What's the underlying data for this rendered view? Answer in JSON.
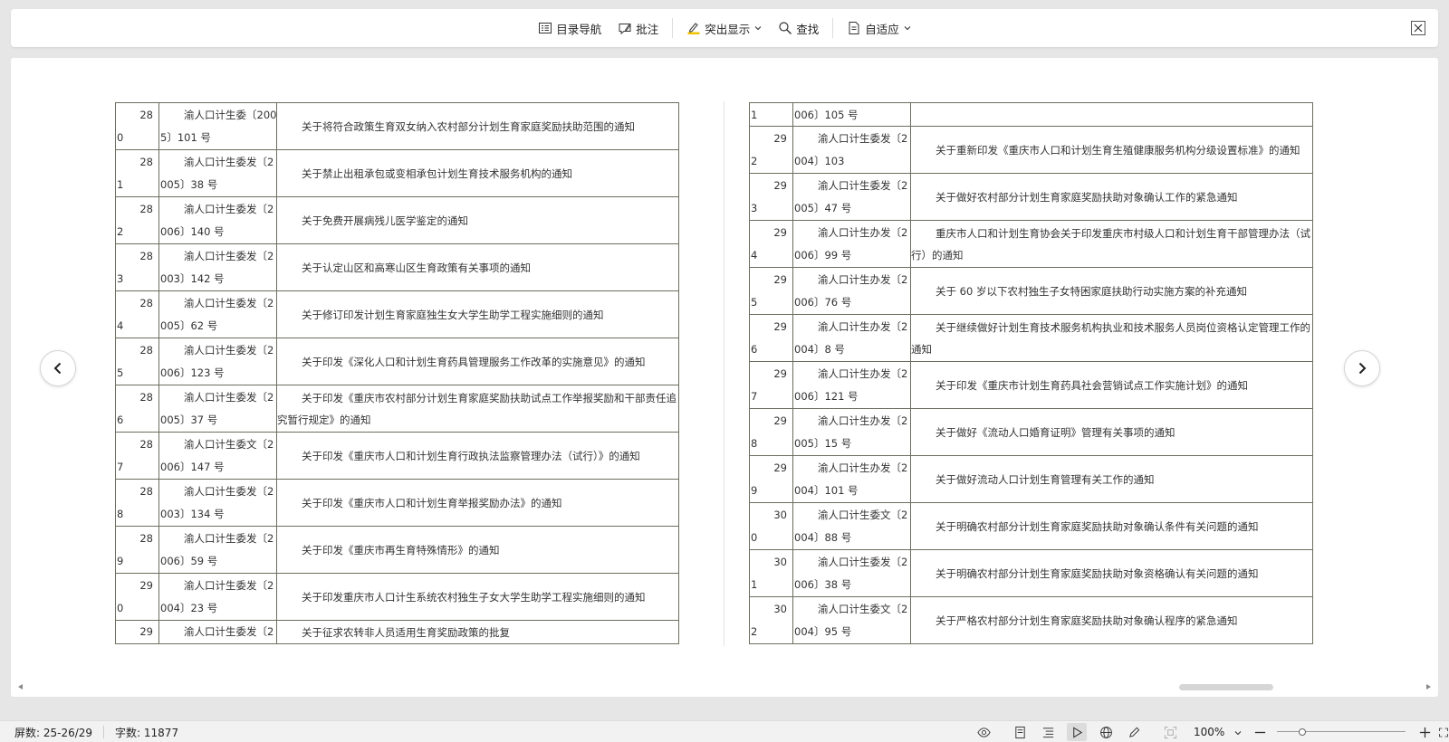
{
  "toolbar": {
    "toc_label": "目录导航",
    "annotate_label": "批注",
    "highlight_label": "突出显示",
    "find_label": "查找",
    "fit_label": "自适应"
  },
  "left_rows": [
    {
      "num1": "28",
      "num2": "0",
      "doc1": "渝人口计生委〔200",
      "doc2": "5〕101 号",
      "title": "关于将符合政策生育双女纳入农村部分计划生育家庭奖励扶助范围的通知"
    },
    {
      "num1": "28",
      "num2": "1",
      "doc1": "渝人口计生委发〔2",
      "doc2": "005〕38 号",
      "title": "关于禁止出租承包或变相承包计划生育技术服务机构的通知"
    },
    {
      "num1": "28",
      "num2": "2",
      "doc1": "渝人口计生委发〔2",
      "doc2": "006〕140 号",
      "title": "关于免费开展病残儿医学鉴定的通知"
    },
    {
      "num1": "28",
      "num2": "3",
      "doc1": "渝人口计生委发〔2",
      "doc2": "003〕142 号",
      "title": "关于认定山区和高寒山区生育政策有关事项的通知"
    },
    {
      "num1": "28",
      "num2": "4",
      "doc1": "渝人口计生委发〔2",
      "doc2": "005〕62 号",
      "title": "关于修订印发计划生育家庭独生女大学生助学工程实施细则的通知"
    },
    {
      "num1": "28",
      "num2": "5",
      "doc1": "渝人口计生委发〔2",
      "doc2": "006〕123 号",
      "title": "关于印发《深化人口和计划生育药具管理服务工作改革的实施意见》的通知"
    },
    {
      "num1": "28",
      "num2": "6",
      "doc1": "渝人口计生委发〔2",
      "doc2": "005〕37 号",
      "title": "关于印发《重庆市农村部分计划生育家庭奖励扶助试点工作举报奖励和干部责任追究暂行规定》的通知"
    },
    {
      "num1": "28",
      "num2": "7",
      "doc1": "渝人口计生委文〔2",
      "doc2": "006〕147 号",
      "title": "关于印发《重庆市人口和计划生育行政执法监察管理办法（试行）》的通知"
    },
    {
      "num1": "28",
      "num2": "8",
      "doc1": "渝人口计生委发〔2",
      "doc2": "003〕134 号",
      "title": "关于印发《重庆市人口和计划生育举报奖励办法》的通知"
    },
    {
      "num1": "28",
      "num2": "9",
      "doc1": "渝人口计生委发〔2",
      "doc2": "006〕59 号",
      "title": "关于印发《重庆市再生育特殊情形》的通知"
    },
    {
      "num1": "29",
      "num2": "0",
      "doc1": "渝人口计生委发〔2",
      "doc2": "004〕23 号",
      "title": "关于印发重庆市人口计生系统农村独生子女大学生助学工程实施细则的通知"
    },
    {
      "num1": "29",
      "num2": "",
      "doc1": "渝人口计生委发〔2",
      "doc2": "",
      "title": "关于征求农转非人员适用生育奖励政策的批复"
    }
  ],
  "right_top_row": {
    "num": "1",
    "doc": "006〕105 号",
    "title": ""
  },
  "right_rows": [
    {
      "num1": "29",
      "num2": "2",
      "doc1": "渝人口计生委发〔2",
      "doc2": "004〕103",
      "title": "关于重新印发《重庆市人口和计划生育生殖健康服务机构分级设置标准》的通知"
    },
    {
      "num1": "29",
      "num2": "3",
      "doc1": "渝人口计生委发〔2",
      "doc2": "005〕47 号",
      "title": "关于做好农村部分计划生育家庭奖励扶助对象确认工作的紧急通知"
    },
    {
      "num1": "29",
      "num2": "4",
      "doc1": "渝人口计生办发〔2",
      "doc2": "006〕99 号",
      "title": "重庆市人口和计划生育协会关于印发重庆市村级人口和计划生育干部管理办法（试行）的通知"
    },
    {
      "num1": "29",
      "num2": "5",
      "doc1": "渝人口计生办发〔2",
      "doc2": "006〕76 号",
      "title": "关于 60 岁以下农村独生子女特困家庭扶助行动实施方案的补充通知"
    },
    {
      "num1": "29",
      "num2": "6",
      "doc1": "渝人口计生办发〔2",
      "doc2": "004〕8 号",
      "title": "关于继续做好计划生育技术服务机构执业和技术服务人员岗位资格认定管理工作的通知"
    },
    {
      "num1": "29",
      "num2": "7",
      "doc1": "渝人口计生办发〔2",
      "doc2": "006〕121 号",
      "title": "关于印发《重庆市计划生育药具社会营销试点工作实施计划》的通知"
    },
    {
      "num1": "29",
      "num2": "8",
      "doc1": "渝人口计生办发〔2",
      "doc2": "005〕15 号",
      "title": "关于做好《流动人口婚育证明》管理有关事项的通知"
    },
    {
      "num1": "29",
      "num2": "9",
      "doc1": "渝人口计生办发〔2",
      "doc2": "004〕101 号",
      "title": "关于做好流动人口计划生育管理有关工作的通知"
    },
    {
      "num1": "30",
      "num2": "0",
      "doc1": "渝人口计生委文〔2",
      "doc2": "004〕88 号",
      "title": "关于明确农村部分计划生育家庭奖励扶助对象确认条件有关问题的通知"
    },
    {
      "num1": "30",
      "num2": "1",
      "doc1": "渝人口计生委发〔2",
      "doc2": "006〕38 号",
      "title": "关于明确农村部分计划生育家庭奖励扶助对象资格确认有关问题的通知"
    },
    {
      "num1": "30",
      "num2": "2",
      "doc1": "渝人口计生委文〔2",
      "doc2": "004〕95 号",
      "title": "关于严格农村部分计划生育家庭奖励扶助对象确认程序的紧急通知"
    }
  ],
  "status": {
    "screens": "屏数: 25-26/29",
    "word_count": "字数: 11877",
    "zoom": "100%",
    "zoom_level_percent": 100
  }
}
